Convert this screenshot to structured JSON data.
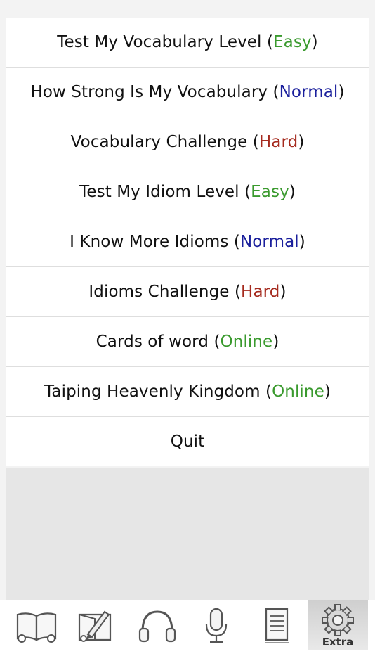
{
  "menu": {
    "items": [
      {
        "label": "Test My Vocabulary Level",
        "tag": "Easy",
        "level": "easy"
      },
      {
        "label": "How Strong Is My Vocabulary",
        "tag": "Normal",
        "level": "normal"
      },
      {
        "label": "Vocabulary Challenge",
        "tag": "Hard",
        "level": "hard"
      },
      {
        "label": "Test My Idiom Level",
        "tag": "Easy",
        "level": "easy"
      },
      {
        "label": "I Know More Idioms",
        "tag": "Normal",
        "level": "normal"
      },
      {
        "label": "Idioms Challenge",
        "tag": "Hard",
        "level": "hard"
      },
      {
        "label": "Cards of word",
        "tag": "Online",
        "level": "online"
      },
      {
        "label": "Taiping Heavenly Kingdom",
        "tag": "Online",
        "level": "online"
      },
      {
        "label": "Quit",
        "tag": null,
        "level": null
      }
    ]
  },
  "colors": {
    "easy": "#3a9a2e",
    "normal": "#1a1f9c",
    "hard": "#a52a1e",
    "online": "#3a9a2e"
  },
  "tabbar": {
    "tabs": [
      {
        "icon": "open-book-icon"
      },
      {
        "icon": "book-pen-icon"
      },
      {
        "icon": "headphones-icon"
      },
      {
        "icon": "microphone-icon"
      },
      {
        "icon": "document-icon"
      },
      {
        "icon": "gear-icon",
        "label": "Extra",
        "active": true
      }
    ]
  }
}
